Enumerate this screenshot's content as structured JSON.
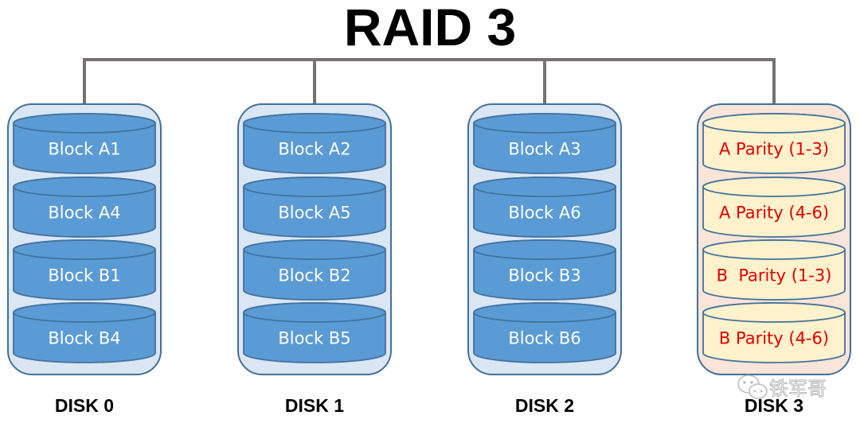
{
  "title": "RAID 3",
  "colors": {
    "connector": "#767171",
    "data_container_fill": "#dae6f4",
    "data_container_stroke": "#41719c",
    "data_block_fill": "#5b9bd5",
    "data_block_top": "#5b9bd5",
    "data_block_stroke": "#41719c",
    "data_text": "#ffffff",
    "parity_container_fill": "#fbe4d8",
    "parity_container_stroke": "#41719c",
    "parity_block_fill": "#fff2cc",
    "parity_block_stroke": "#41719c",
    "parity_text": "#e00000"
  },
  "disks": [
    {
      "label": "DISK 0",
      "type": "data",
      "blocks": [
        "Block A1",
        "Block A4",
        "Block B1",
        "Block B4"
      ]
    },
    {
      "label": "DISK 1",
      "type": "data",
      "blocks": [
        "Block A2",
        "Block A5",
        "Block B2",
        "Block B5"
      ]
    },
    {
      "label": "DISK 2",
      "type": "data",
      "blocks": [
        "Block A3",
        "Block A6",
        "Block B3",
        "Block B6"
      ]
    },
    {
      "label": "DISK 3",
      "type": "parity",
      "blocks": [
        "A Parity (1-3)",
        "A Parity (4-6)",
        "B  Parity (1-3)",
        "B Parity (4-6)"
      ]
    }
  ],
  "watermark": {
    "icon": "wechat-icon",
    "text": "铁军哥"
  }
}
